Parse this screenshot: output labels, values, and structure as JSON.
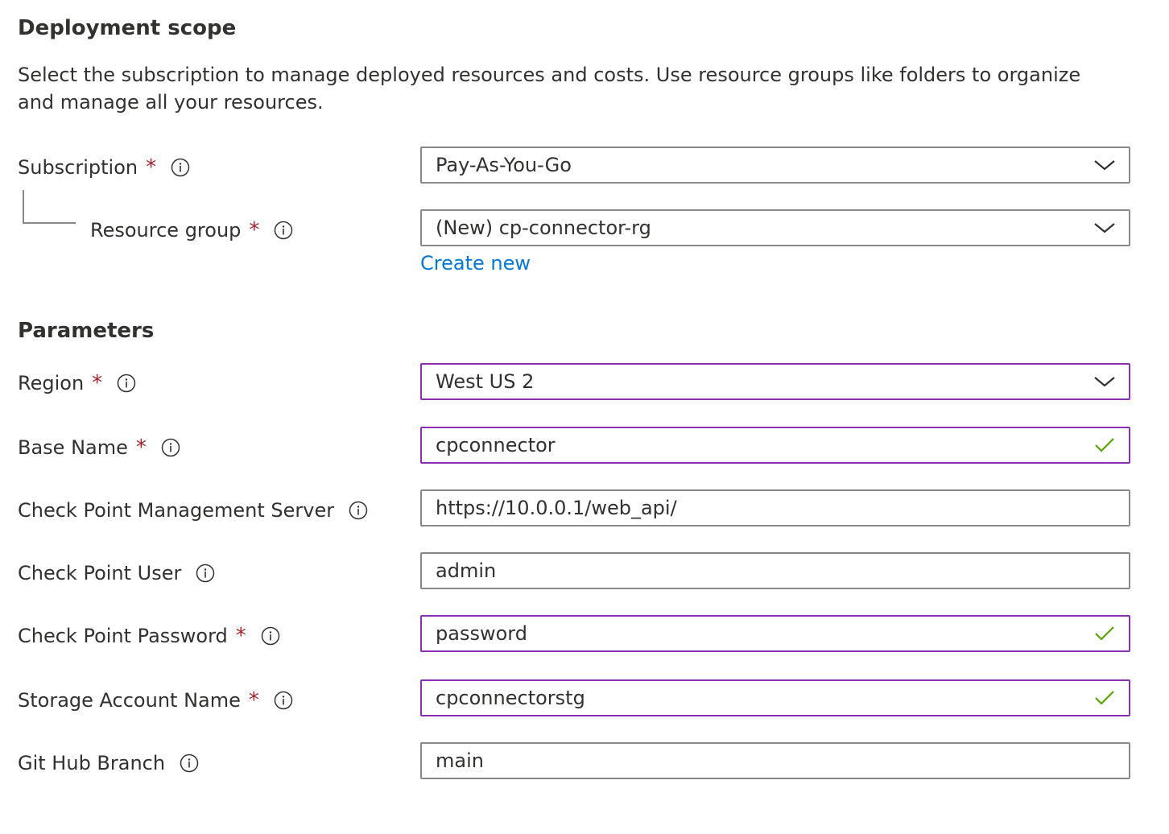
{
  "deployment_scope": {
    "heading": "Deployment scope",
    "description": "Select the subscription to manage deployed resources and costs. Use resource groups like folders to organize and manage all your resources.",
    "subscription": {
      "label": "Subscription",
      "required": "*",
      "value": "Pay-As-You-Go"
    },
    "resource_group": {
      "label": "Resource group",
      "required": "*",
      "value": "(New) cp-connector-rg",
      "create_new": "Create new"
    }
  },
  "parameters": {
    "heading": "Parameters",
    "region": {
      "label": "Region",
      "required": "*",
      "value": "West US 2"
    },
    "base_name": {
      "label": "Base Name",
      "required": "*",
      "value": "cpconnector"
    },
    "mgmt_server": {
      "label": "Check Point Management Server",
      "value": "https://10.0.0.1/web_api/"
    },
    "user": {
      "label": "Check Point User",
      "value": "admin"
    },
    "password": {
      "label": "Check Point Password",
      "required": "*",
      "value": "password"
    },
    "storage_account": {
      "label": "Storage Account Name",
      "required": "*",
      "value": "cpconnectorstg"
    },
    "github_branch": {
      "label": "Git Hub Branch",
      "value": "main"
    }
  },
  "colors": {
    "required": "#a4262c",
    "link": "#0078d4",
    "focus_border": "#8a2fb0",
    "valid_check": "#57a300",
    "border": "#8a8886"
  },
  "icons": {
    "info": "info-icon",
    "dropdown": "chevron-down-icon",
    "valid": "checkmark-icon"
  }
}
